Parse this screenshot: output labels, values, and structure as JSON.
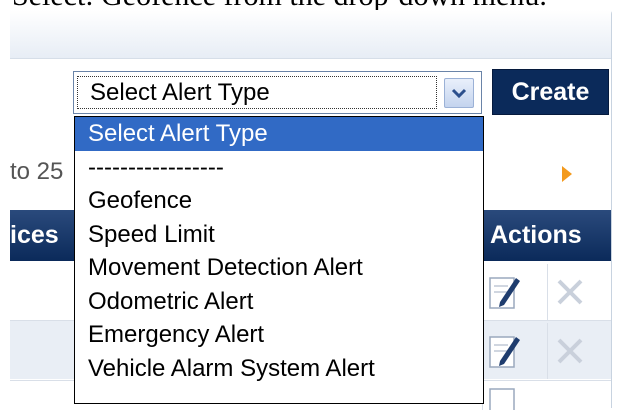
{
  "caption": "Select: Geofence from the drop-down menu.",
  "alert_select": {
    "value": "Select Alert Type",
    "options": [
      "Select Alert Type",
      "-----------------",
      "Geofence",
      "Speed Limit",
      "Movement Detection Alert",
      "Odometric Alert",
      "Emergency Alert",
      "Vehicle Alarm System Alert"
    ],
    "selected_index": 0
  },
  "toolbar": {
    "create_label": "Create"
  },
  "pager": {
    "text": "to 25"
  },
  "table": {
    "col_devices": "ices",
    "col_actions": "Actions"
  },
  "icons": {
    "dropdown_arrow": "chevron-down-icon",
    "edit": "edit-icon",
    "delete": "delete-icon",
    "next": "next-page-icon"
  },
  "colors": {
    "header": "#0b2a5a",
    "selection": "#316ac5",
    "pager_arrow": "#f39a1d"
  }
}
